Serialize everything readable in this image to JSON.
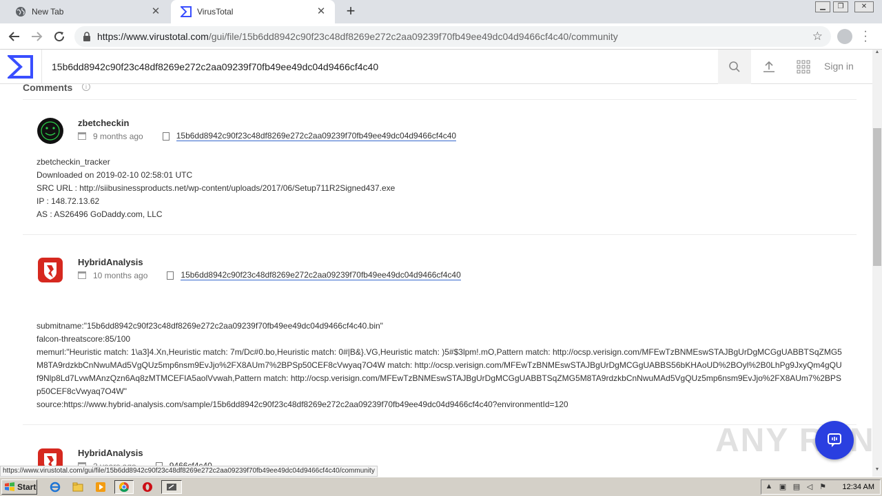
{
  "browser": {
    "tabs": [
      {
        "label": "New Tab",
        "active": false
      },
      {
        "label": "VirusTotal",
        "active": true
      }
    ],
    "url_host": "https://www.virustotal.com",
    "url_path": "/gui/file/15b6dd8942c90f23c48df8269e272c2aa09239f70fb49ee49dc04d9466cf4c40/community",
    "status_url": "https://www.virustotal.com/gui/file/15b6dd8942c90f23c48df8269e272c2aa09239f70fb49ee49dc04d9466cf4c40/community"
  },
  "header": {
    "search_value": "15b6dd8942c90f23c48df8269e272c2aa09239f70fb49ee49dc04d9466cf4c40",
    "sign_in": "Sign in"
  },
  "section": {
    "title": "Comments",
    "info": "i"
  },
  "comments": [
    {
      "author": "zbetcheckin",
      "age": "9 months ago",
      "hash": "15b6dd8942c90f23c48df8269e272c2aa09239f70fb49ee49dc04d9466cf4c40",
      "lines": [
        "zbetcheckin_tracker",
        "Downloaded on 2019-02-10 02:58:01 UTC",
        "SRC URL : http://siibusinessproducts.net/wp-content/uploads/2017/06/Setup711R2Signed437.exe",
        "IP : 148.72.13.62",
        "AS : AS26496 GoDaddy.com, LLC"
      ]
    },
    {
      "author": "HybridAnalysis",
      "age": "10 months ago",
      "hash": "15b6dd8942c90f23c48df8269e272c2aa09239f70fb49ee49dc04d9466cf4c40",
      "submitname": "submitname:\"15b6dd8942c90f23c48df8269e272c2aa09239f70fb49ee49dc04d9466cf4c40.bin\"",
      "threatscore": "falcon-threatscore:85/100",
      "memurl": "memurl:\"Heuristic match: 1\\a3]4.Xn,Heuristic match: 7m/Dc#0.bo,Heuristic match: 0#|B&}.VG,Heuristic match: )5#$3lpm!.mO,Pattern match: http://ocsp.verisign.com/MFEwTzBNMEswSTAJBgUrDgMCGgUABBTSqZMG5M8TA9rdzkbCnNwuMAd5VgQUz5mp6nsm9EvJjo%2FX8AUm7%2BPSp50CEF8cVwyaq7O4W match: http://ocsp.verisign.com/MFEwTzBNMEswSTAJBgUrDgMCGgUABBS56bKHAoUD%2BOyl%2B0LhPg9JxyQm4gQUf9Nlp8Ld7LvwMAnzQzn6Aq8zMTMCEFIA5aolVvwah,Pattern match: http://ocsp.verisign.com/MFEwTzBNMEswSTAJBgUrDgMCGgUABBTSqZMG5M8TA9rdzkbCnNwuMAd5VgQUz5mp6nsm9EvJjo%2FX8AUm7%2BPSp50CEF8cVwyaq7O4W\"",
      "source": "source:https://www.hybrid-analysis.com/sample/15b6dd8942c90f23c48df8269e272c2aa09239f70fb49ee49dc04d9466cf4c40?environmentId=120"
    },
    {
      "author": "HybridAnalysis",
      "age": "2 years ago",
      "hash_visible": "9466cf4c40"
    }
  ],
  "watermark": "ANY RUN",
  "taskbar": {
    "start": "Start",
    "clock": "12:34 AM"
  },
  "colors": {
    "vt_blue": "#394eff",
    "link_underline": "#3366cc",
    "fab_blue": "#2a3fe0",
    "hybrid_red": "#d6281f"
  }
}
